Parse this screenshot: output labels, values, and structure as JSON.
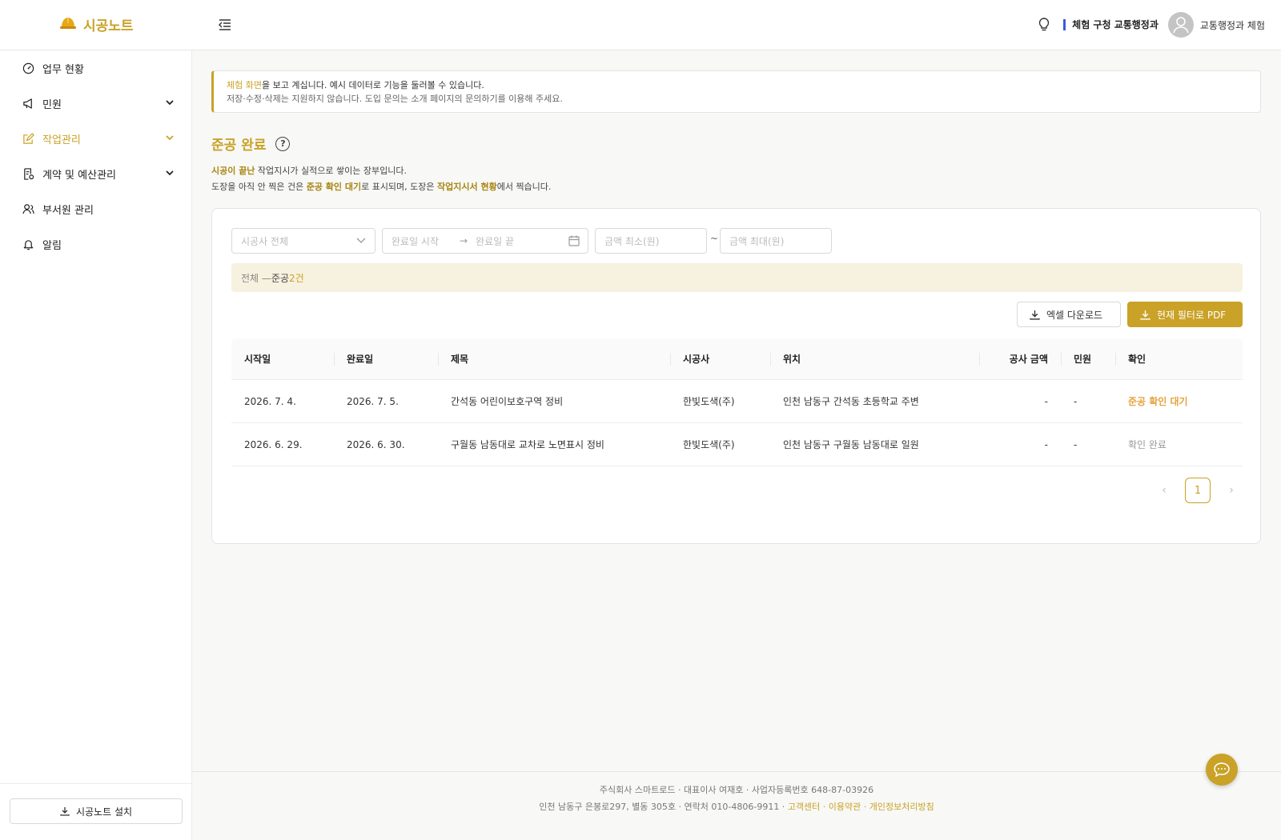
{
  "app": {
    "name": "시공노트"
  },
  "header": {
    "org_label": "체험 구청 교통행정과",
    "user_name": "교통행정과 체험"
  },
  "sidebar": {
    "items": [
      {
        "label": "업무 현황",
        "icon": "dashboard-icon",
        "expandable": false,
        "active": false
      },
      {
        "label": "민원",
        "icon": "megaphone-icon",
        "expandable": true,
        "active": false
      },
      {
        "label": "작업관리",
        "icon": "edit-icon",
        "expandable": true,
        "active": true
      },
      {
        "label": "계약 및 예산관리",
        "icon": "contract-icon",
        "expandable": true,
        "active": false
      },
      {
        "label": "부서원 관리",
        "icon": "users-icon",
        "expandable": false,
        "active": false
      },
      {
        "label": "알림",
        "icon": "bell-icon",
        "expandable": false,
        "active": false
      }
    ],
    "install_label": "시공노트 설치"
  },
  "notice": {
    "highlight": "체험 화면",
    "line1_rest": "을 보고 계십니다. 예시 데이터로 기능을 둘러볼 수 있습니다.",
    "line2": "저장·수정·삭제는 지원하지 않습니다. 도입 문의는 소개 페이지의 문의하기를 이용해 주세요."
  },
  "page": {
    "title": "준공 완료",
    "help": "?",
    "desc1_bold": "시공이 끝난",
    "desc1_rest": " 작업지시가 실적으로 쌓이는 장부입니다.",
    "desc2_a": "도장을 아직 안 찍은 건은 ",
    "desc2_bold1": "준공 확인 대기",
    "desc2_b": "로 표시되며, 도장은 ",
    "desc2_bold2": "작업지시서 현황",
    "desc2_c": "에서 찍습니다."
  },
  "filters": {
    "company_placeholder": "시공사 전체",
    "date_start_placeholder": "완료일 시작",
    "date_end_placeholder": "완료일 끝",
    "amount_min_placeholder": "금액 최소(원)",
    "amount_max_placeholder": "금액 최대(원)",
    "tilde": "~"
  },
  "summary": {
    "prefix": "전체 — ",
    "label": "준공 ",
    "count": "2건"
  },
  "actions": {
    "excel": "엑셀 다운로드",
    "pdf": "현재 필터로 PDF"
  },
  "table": {
    "headers": [
      "시작일",
      "완료일",
      "제목",
      "시공사",
      "위치",
      "공사 금액",
      "민원",
      "확인"
    ],
    "rows": [
      {
        "start": "2026. 7. 4.",
        "end": "2026. 7. 5.",
        "title": "간석동 어린이보호구역 정비",
        "company": "한빛도색(주)",
        "location": "인천 남동구 간석동 초등학교 주변",
        "amount": "-",
        "complaints": "-",
        "status": "준공 확인 대기",
        "status_type": "wait"
      },
      {
        "start": "2026. 6. 29.",
        "end": "2026. 6. 30.",
        "title": "구월동 남동대로 교차로 노면표시 정비",
        "company": "한빛도색(주)",
        "location": "인천 남동구 구월동 남동대로 일원",
        "amount": "-",
        "complaints": "-",
        "status": "확인 완료",
        "status_type": "done"
      }
    ]
  },
  "pagination": {
    "current": "1"
  },
  "footer": {
    "line1": "주식회사 스마트로드 · 대표이사 여재호 · 사업자등록번호 648-87-03926",
    "line2": "인천 남동구 은봉로297, 별동 305호 · 연락처 010-4806-9911 · ",
    "links": [
      "고객센터",
      "이용약관",
      "개인정보처리방침"
    ],
    "link_sep": " · "
  },
  "colors": {
    "accent": "#c9a227",
    "wait": "#e6a23c",
    "org_bar": "#3a5bd9"
  }
}
